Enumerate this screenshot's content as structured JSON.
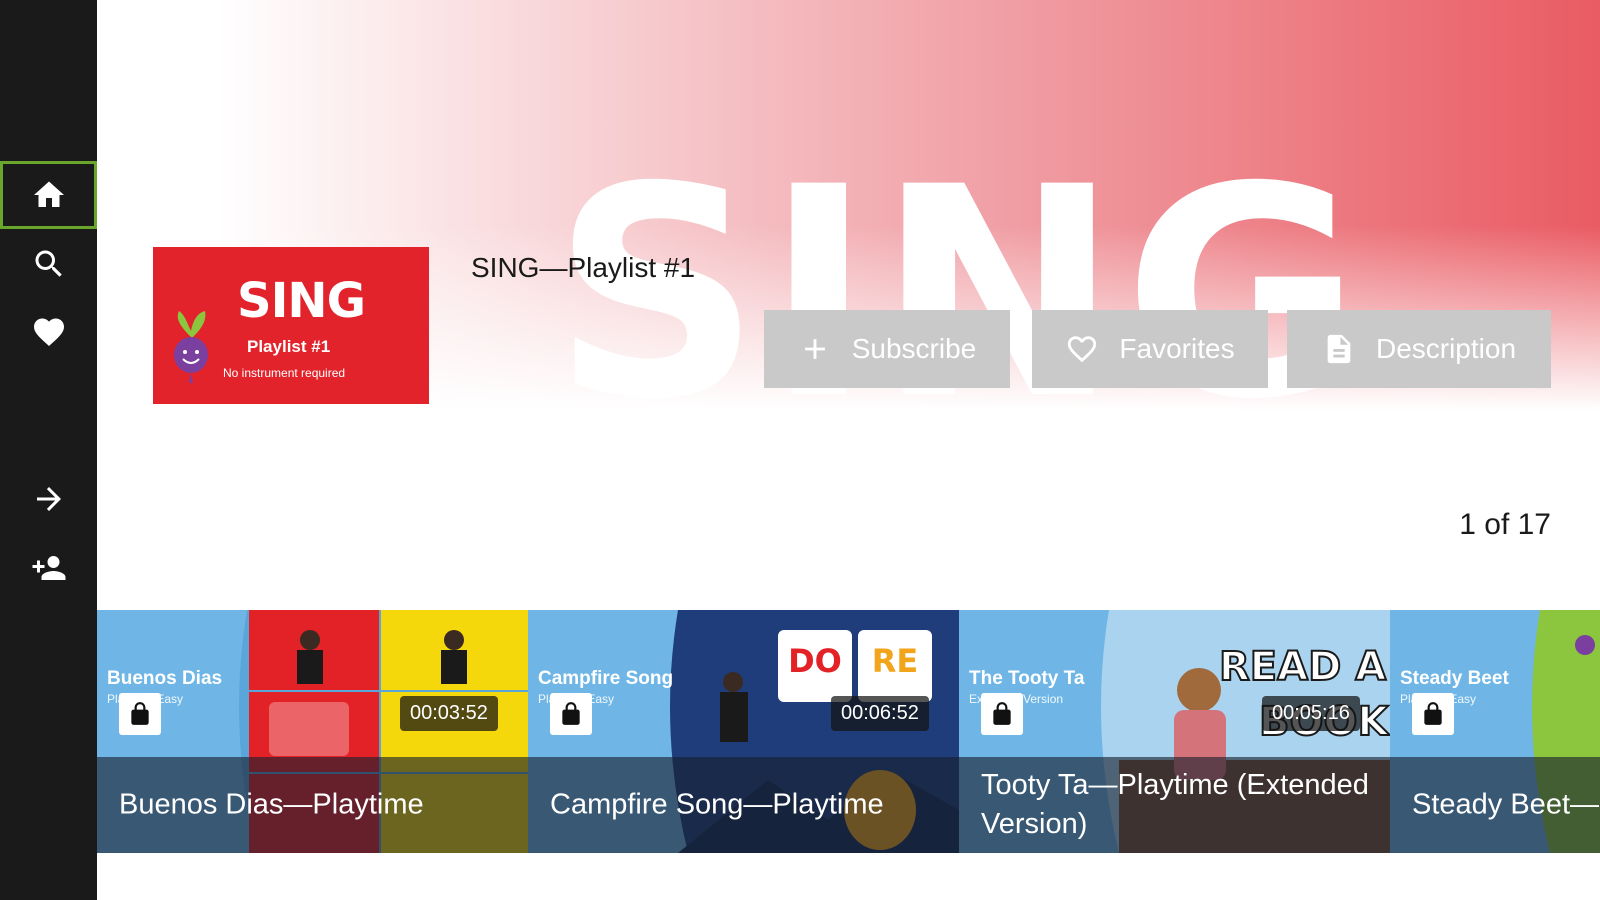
{
  "sidebar": {
    "items": [
      {
        "name": "home",
        "icon": "home-icon",
        "selected": true
      },
      {
        "name": "search",
        "icon": "search-icon",
        "selected": false
      },
      {
        "name": "favorites",
        "icon": "heart-icon",
        "selected": false
      },
      {
        "name": "sign-in",
        "icon": "arrow-right-icon",
        "selected": false
      },
      {
        "name": "add-user",
        "icon": "person-add-icon",
        "selected": false
      }
    ],
    "selected_color": "#6aa52c"
  },
  "hero": {
    "background_word": "SING",
    "accent_color": "#ea5b63"
  },
  "playlist": {
    "thumbnail": {
      "title": "SING",
      "subtitle": "Playlist #1",
      "note": "No instrument required"
    },
    "title": "SING—Playlist #1",
    "actions": {
      "subscribe": "Subscribe",
      "favorites": "Favorites",
      "description": "Description"
    },
    "count": "1 of 17"
  },
  "videos": [
    {
      "title": "Buenos Dias—Playtime",
      "duration": "00:03:52",
      "art_title": "Buenos Dias",
      "art_sub": "Playtime Easy",
      "locked": true
    },
    {
      "title": "Campfire Song—Playtime",
      "duration": "00:06:52",
      "art_title": "Campfire Song",
      "art_sub": "Playtime Easy",
      "locked": true
    },
    {
      "title": "Tooty Ta—Playtime (Extended Version)",
      "duration": "00:05:16",
      "art_title": "The Tooty Ta",
      "art_sub": "Extended Version",
      "locked": true
    },
    {
      "title": "Steady Beet—",
      "duration": "",
      "art_title": "Steady Beet",
      "art_sub": "Playtime Easy",
      "locked": true
    }
  ]
}
